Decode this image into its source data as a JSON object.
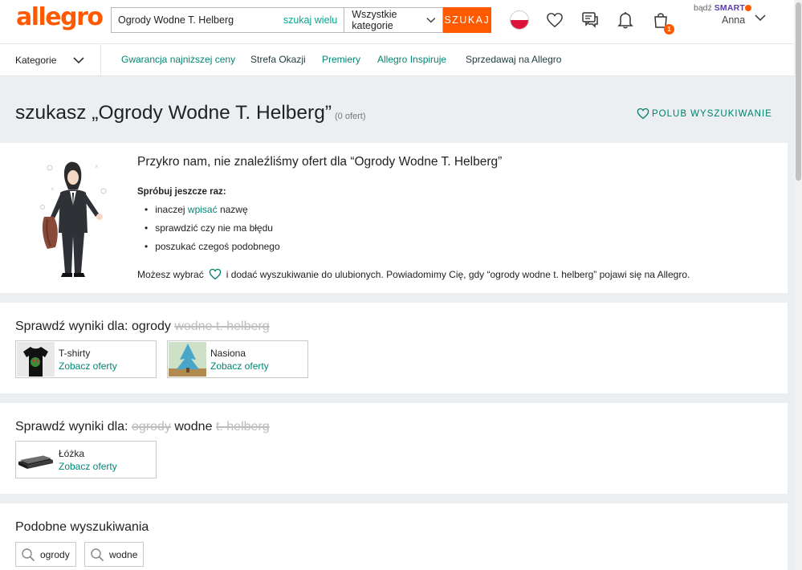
{
  "brand": {
    "logo": "allegro",
    "accent": "#ff5a00",
    "link_color": "#008673"
  },
  "search": {
    "query": "Ogrody Wodne T. Helberg",
    "multi_label": "szukaj wielu",
    "category": "Wszystkie kategorie",
    "button": "SZUKAJ"
  },
  "header": {
    "smart_prefix": "bądź",
    "smart_label": "SMART",
    "user_name": "Anna",
    "cart_count": "1",
    "icons": [
      "poland-flag-icon",
      "heart-icon",
      "messages-icon",
      "bell-icon",
      "cart-icon",
      "chevron-down-icon"
    ]
  },
  "nav": {
    "categories_label": "Kategorie",
    "links": [
      "Gwarancja najniższej ceny",
      "Strefa Okazji",
      "Premiery",
      "Allegro Inspiruje",
      "Sprzedawaj na Allegro"
    ]
  },
  "title": {
    "prefix": "szukasz „Ogrody Wodne T. Helberg”",
    "count": "(0 ofert)",
    "favorite_button": "POLUB WYSZUKIWANIE"
  },
  "no_results": {
    "heading": "Przykro nam, nie znaleźliśmy ofert dla “Ogrody Wodne T. Helberg”",
    "try_again": "Spróbuj jeszcze raz:",
    "tip1_pre": "inaczej",
    "tip1_link": "wpisać",
    "tip1_post": "nazwę",
    "tip2": "sprawdzić czy nie ma błędu",
    "tip3": "poszukać czegoś podobnego",
    "note_pre": "Możesz wybrać",
    "note_post": "i dodać wyszukiwanie do ulubionych. Powiadomimy Cię, gdy “ogrody wodne t. helberg” pojawi się na Allegro."
  },
  "section1": {
    "label": "Sprawdź wyniki dla:",
    "kept": "ogrody",
    "struck": "wodne t. helberg",
    "results": [
      {
        "name": "T-shirty",
        "link": "Zobacz oferty"
      },
      {
        "name": "Nasiona",
        "link": "Zobacz oferty"
      }
    ]
  },
  "section2": {
    "label": "Sprawdź wyniki dla:",
    "struck_before": "ogrody",
    "kept": "wodne",
    "struck_after": "t. helberg",
    "results": [
      {
        "name": "Łóżka",
        "link": "Zobacz oferty"
      }
    ]
  },
  "similar": {
    "heading": "Podobne wyszukiwania",
    "items": [
      "ogrody",
      "wodne"
    ]
  }
}
